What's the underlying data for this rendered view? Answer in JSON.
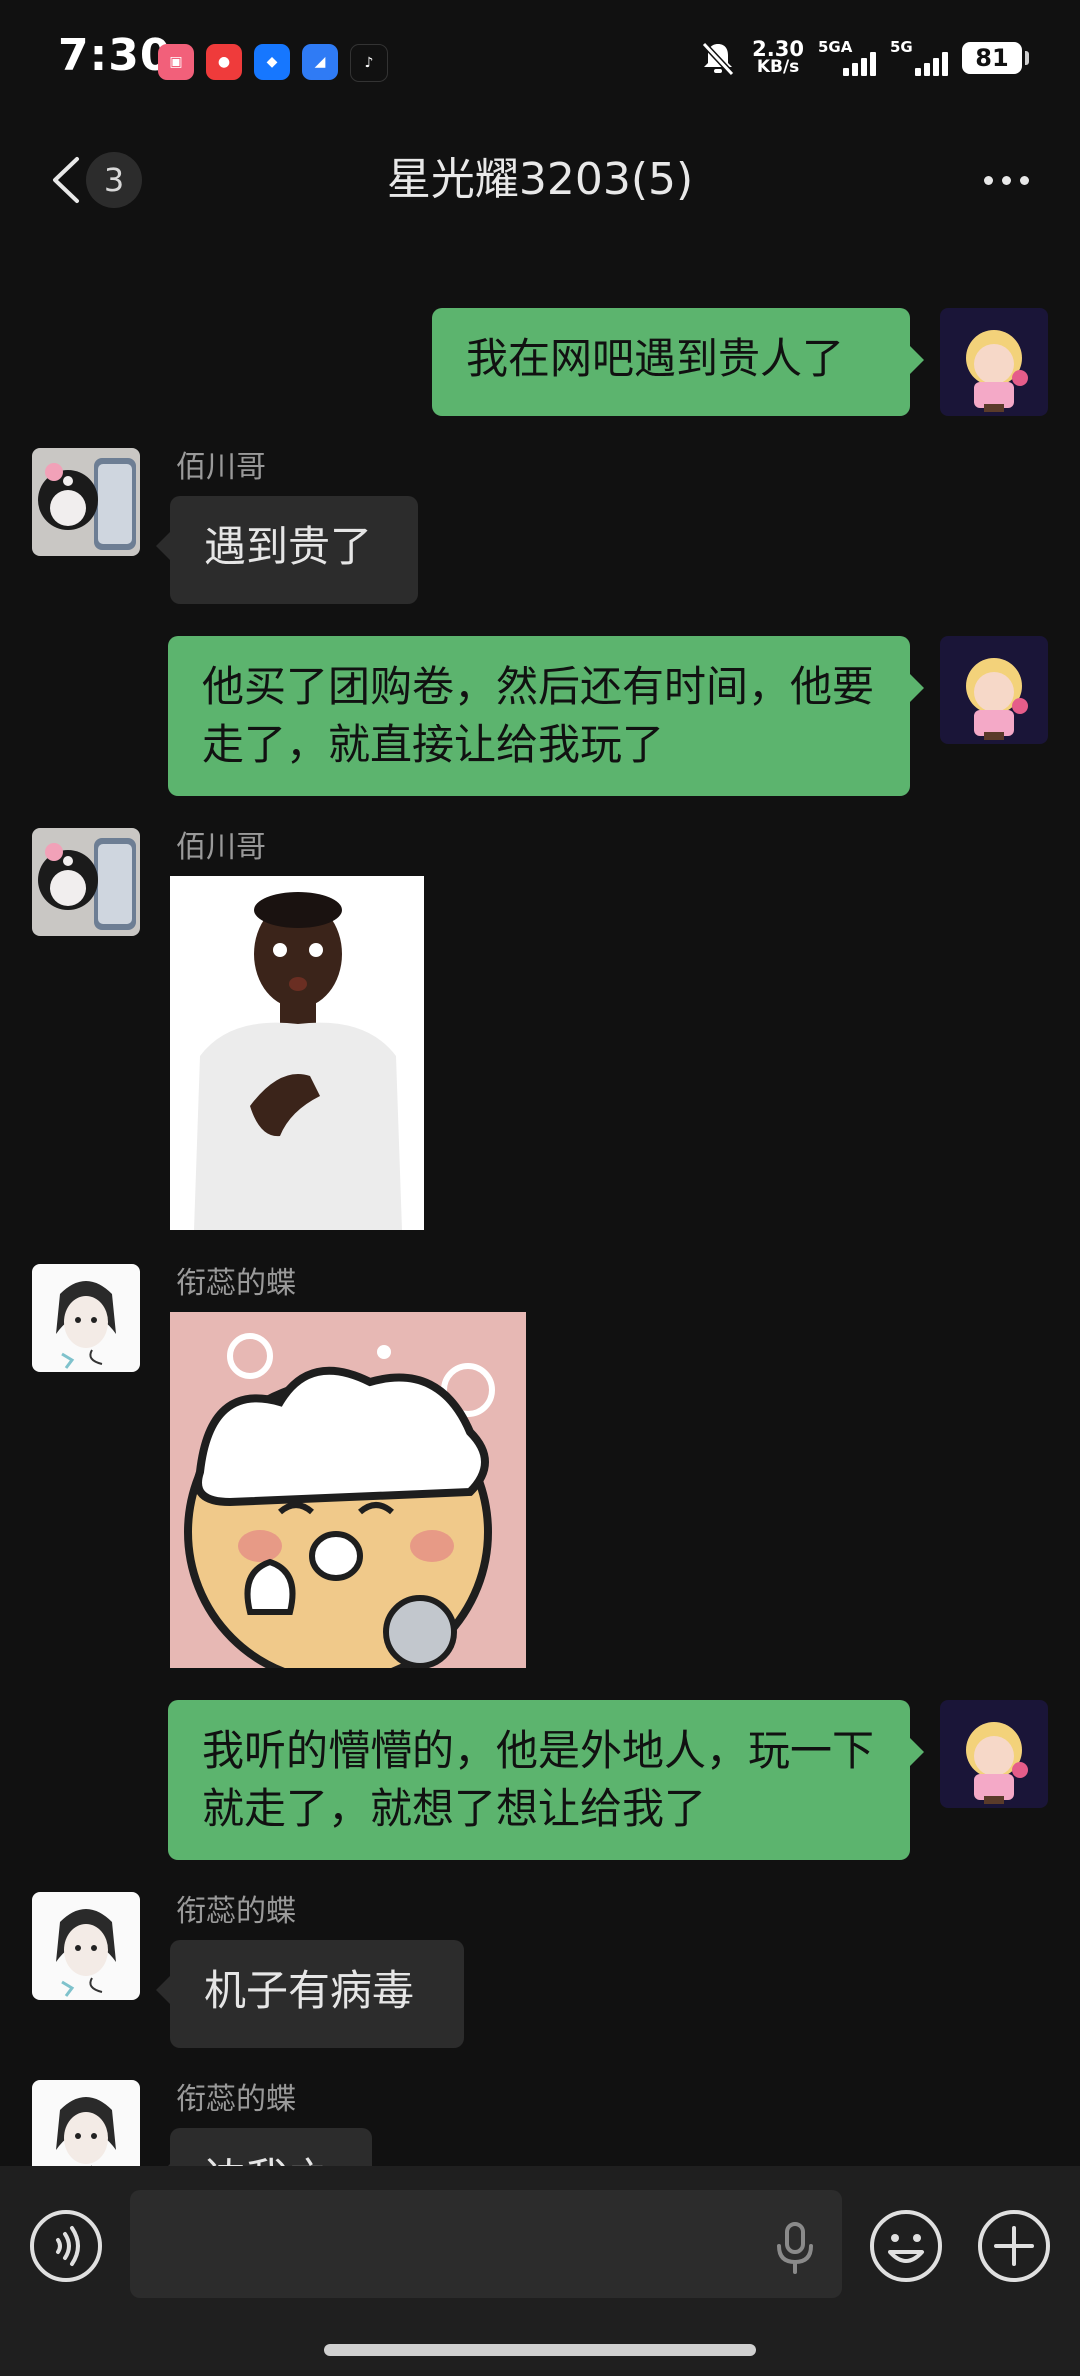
{
  "status_bar": {
    "time": "7:30",
    "net_speed_value": "2.30",
    "net_speed_unit": "KB/s",
    "sim1_label": "5GA",
    "sim2_label": "5G",
    "battery": "81",
    "notification_icons": [
      "lofter-icon",
      "xiaohongshu-icon",
      "alipay-icon",
      "feishu-icon",
      "douyin-icon"
    ]
  },
  "header": {
    "unread_count": "3",
    "title": "星光耀3203(5)"
  },
  "messages": [
    {
      "side": "right",
      "type": "text",
      "text": "我在网吧遇到贵人了"
    },
    {
      "side": "left",
      "type": "text",
      "sender": "佰川哥",
      "text": "遇到贵了"
    },
    {
      "side": "right",
      "type": "text",
      "text": "他买了团购卷，然后还有时间，他要走了，就直接让给我玩了"
    },
    {
      "side": "left",
      "type": "image",
      "sender": "佰川哥"
    },
    {
      "side": "left",
      "type": "image",
      "sender": "衔蕊的蝶"
    },
    {
      "side": "right",
      "type": "text",
      "text": "我听的懵懵的，他是外地人，玩一下就走了，就想了想让给我了"
    },
    {
      "side": "left",
      "type": "text",
      "sender": "衔蕊的蝶",
      "text": "机子有病毒"
    },
    {
      "side": "left",
      "type": "text",
      "sender": "衔蕊的蝶",
      "text": "边我之"
    }
  ],
  "input": {
    "value": "",
    "placeholder": ""
  },
  "colors": {
    "background": "#111111",
    "outgoing_bubble": "#5cb46e",
    "incoming_bubble": "#2c2c2c"
  }
}
